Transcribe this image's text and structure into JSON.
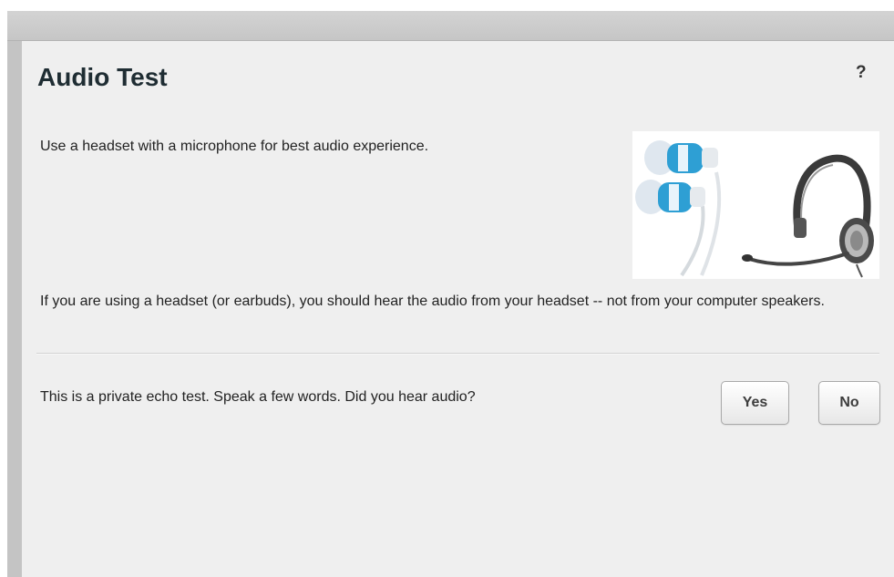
{
  "dialog": {
    "title": "Audio Test",
    "help_label": "?",
    "intro_text": "Use a headset with a microphone for best audio experience.",
    "headset_info": "If you are using a headset (or earbuds), you should hear the audio from your headset -- not from your computer speakers.",
    "echo_prompt": "This is a private echo test.  Speak a few words.  Did you hear audio?",
    "yes_label": "Yes",
    "no_label": "No"
  },
  "colors": {
    "panel_background": "#efefef",
    "frame_background": "#c4c4c4",
    "title_text": "#1f2d33",
    "earbud_accent": "#2e9fd4"
  },
  "illustration": {
    "icons": [
      "earbuds-icon",
      "headset-icon"
    ]
  }
}
